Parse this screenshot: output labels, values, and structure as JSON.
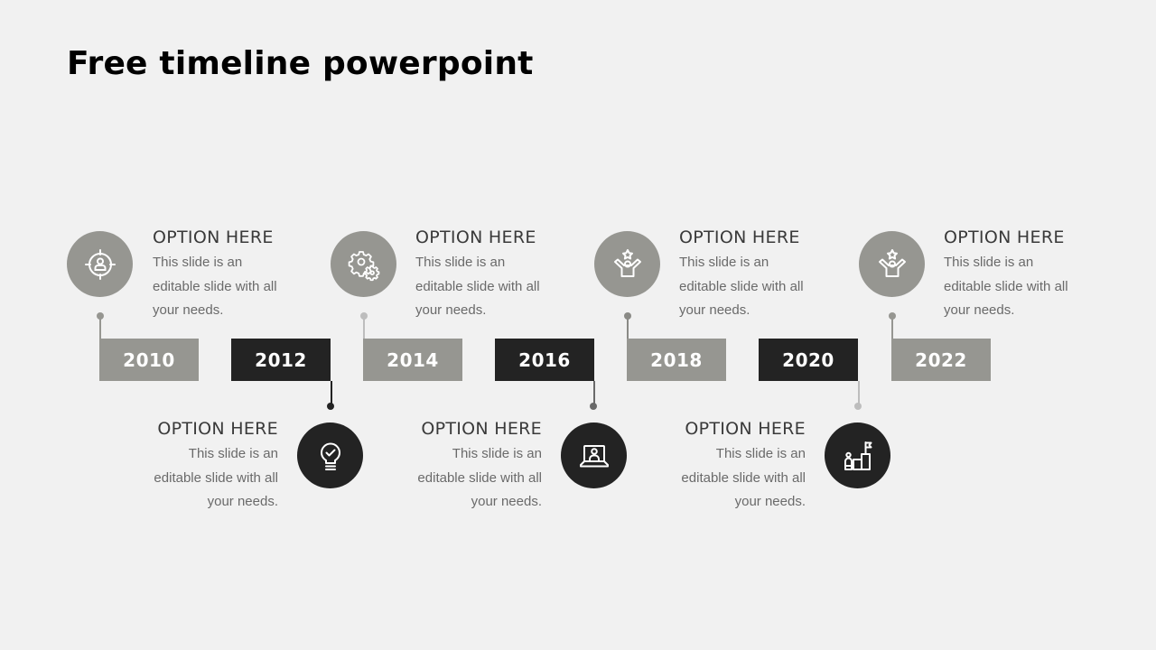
{
  "title": "Free timeline powerpoint",
  "colors": {
    "gray": "#969691",
    "dark": "#232323",
    "background": "#f1f1f1"
  },
  "years": [
    "2010",
    "2012",
    "2014",
    "2016",
    "2018",
    "2020",
    "2022"
  ],
  "events": [
    {
      "year": "2010",
      "position": "top",
      "icon": "target-person-icon",
      "heading": "OPTION HERE",
      "desc": "This slide is an editable slide with all your needs."
    },
    {
      "year": "2012",
      "position": "bottom",
      "icon": "lightbulb-check-icon",
      "heading": "OPTION HERE",
      "desc": "This slide is an editable slide with all your needs."
    },
    {
      "year": "2014",
      "position": "top",
      "icon": "gears-icon",
      "heading": "OPTION HERE",
      "desc": "This slide is an editable slide with all your needs."
    },
    {
      "year": "2016",
      "position": "bottom",
      "icon": "laptop-user-icon",
      "heading": "OPTION HERE",
      "desc": "This slide is an editable slide with all your needs."
    },
    {
      "year": "2018",
      "position": "top",
      "icon": "celebrating-person-star-icon",
      "heading": "OPTION HERE",
      "desc": "This slide is an editable slide with all your needs."
    },
    {
      "year": "2020",
      "position": "bottom",
      "icon": "podium-flag-icon",
      "heading": "OPTION HERE",
      "desc": "This slide is an editable slide with all your needs."
    },
    {
      "year": "2022",
      "position": "top",
      "icon": "celebrating-person-star-icon",
      "heading": "OPTION HERE",
      "desc": "This slide is an editable slide with all your needs."
    }
  ]
}
